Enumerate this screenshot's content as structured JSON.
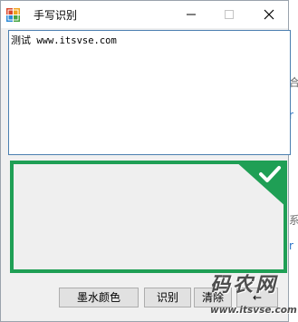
{
  "window": {
    "title": "手写识别",
    "controls": [
      "minimize",
      "maximize",
      "close"
    ]
  },
  "text_output": {
    "prefix": "测试",
    "url": " www.itsvse.com"
  },
  "ink_pad": {
    "border_color": "#1f9f55",
    "badge_icon": "check-icon"
  },
  "buttons": {
    "ink_color": "墨水颜色",
    "recognize": "识别",
    "clear": "清除",
    "backspace": "←"
  },
  "background_letters": [
    "合",
    "r",
    "系",
    "r"
  ],
  "watermark": {
    "main": "码农网",
    "sub": "www.itsvse.com"
  }
}
